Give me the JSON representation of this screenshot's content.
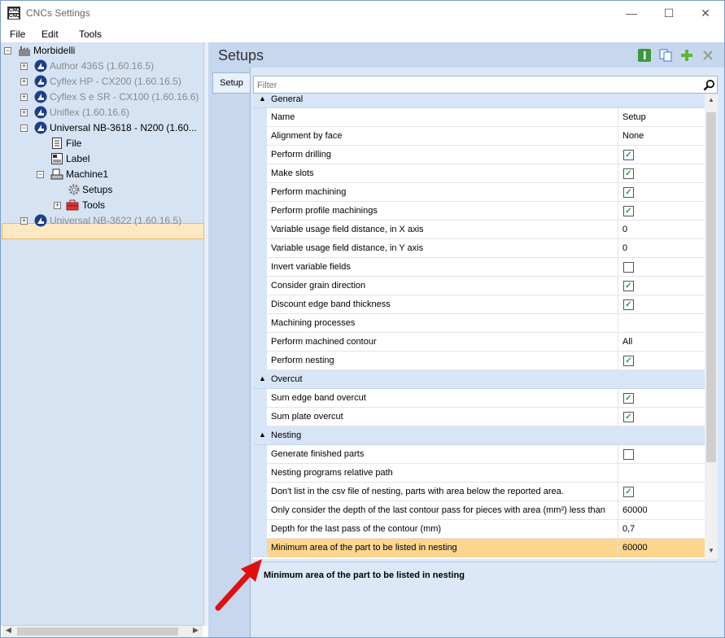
{
  "window": {
    "title": "CNCs Settings",
    "app_icon_text_top": "CNC",
    "app_icon_text_bottom": "CNC"
  },
  "menu": [
    "File",
    "Edit",
    "Tools"
  ],
  "tree": {
    "root": "Morbidelli",
    "machines": [
      {
        "label": "Author 436S (1.60.16.5)"
      },
      {
        "label": "Cyflex HP - CX200 (1.60.16.5)"
      },
      {
        "label": "Cyflex S e SR - CX100 (1.60.16.6)"
      },
      {
        "label": "Uniflex (1.60.16.6)"
      },
      {
        "label": "Universal NB-3618 - N200 (1.60..."
      },
      {
        "label": "Universal NB-3622 (1.60.16.5)"
      }
    ],
    "children": {
      "file": "File",
      "label": "Label",
      "machine1": "Machine1",
      "setups": "Setups",
      "tools": "Tools"
    }
  },
  "main": {
    "title": "Setups",
    "tab": "Setup",
    "filter_placeholder": "Filter",
    "categories": {
      "general": "General",
      "overcut": "Overcut",
      "nesting": "Nesting"
    },
    "header": {
      "name": "Name",
      "value": "Setup"
    },
    "general_rows": [
      {
        "name": "Alignment by face",
        "value": "None"
      },
      {
        "name": "Perform drilling",
        "checked": true
      },
      {
        "name": "Make slots",
        "checked": true
      },
      {
        "name": "Perform machining",
        "checked": true
      },
      {
        "name": "Perform profile machinings",
        "checked": true
      },
      {
        "name": "Variable usage field distance, in X axis",
        "value": "0"
      },
      {
        "name": "Variable usage field distance, in Y axis",
        "value": "0"
      },
      {
        "name": "Invert variable fields",
        "checked": false
      },
      {
        "name": "Consider grain direction",
        "checked": true
      },
      {
        "name": "Discount edge band thickness",
        "checked": true
      },
      {
        "name": "Machining processes",
        "value": ""
      },
      {
        "name": "Perform machined contour",
        "value": "All"
      },
      {
        "name": "Perform nesting",
        "checked": true
      }
    ],
    "overcut_rows": [
      {
        "name": "Sum edge band overcut",
        "checked": true
      },
      {
        "name": "Sum plate overcut",
        "checked": true
      }
    ],
    "nesting_rows": [
      {
        "name": "Generate finished parts",
        "checked": false
      },
      {
        "name": "Nesting programs relative path",
        "value": ""
      },
      {
        "name": "Don't list in the csv file of nesting, parts with area below the reported area.",
        "checked": true
      },
      {
        "name": "Only consider the depth of the last contour pass for pieces with area (mm²) less than",
        "value": "60000"
      },
      {
        "name": "Depth for the last pass of the contour (mm)",
        "value": "0,7"
      },
      {
        "name": "Minimum area of the part to be listed in nesting",
        "value": "60000"
      }
    ],
    "description": "Minimum area of the part to be listed in nesting"
  },
  "colors": {
    "accent_highlight": "#fcd58f",
    "pane_bg": "#d6e3f3",
    "check_green": "#2a9d3e",
    "annotation_red": "#e01010"
  }
}
